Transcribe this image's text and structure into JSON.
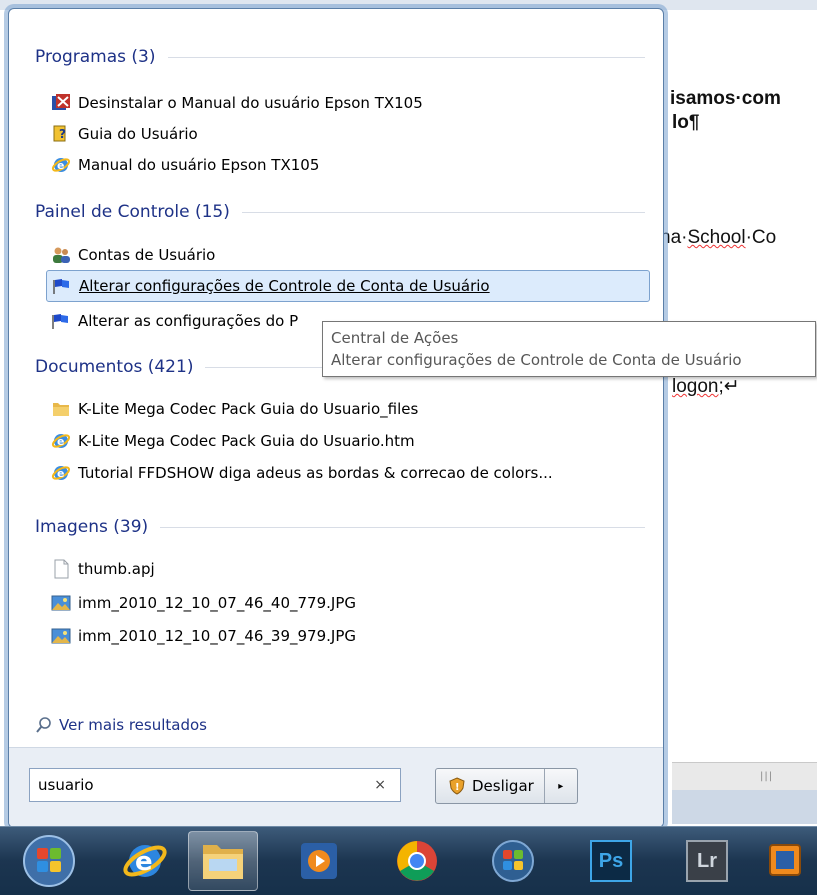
{
  "background_document": {
    "line1": "isamos·com",
    "line2": "lo¶",
    "line3_prefix": "na·",
    "line3_word": "School",
    "line3_suffix": "·Co",
    "line4_word": "logon",
    "line4_suffix": ";↵"
  },
  "groups": {
    "programs": {
      "title": "Programas (3)",
      "items": [
        {
          "label": "Desinstalar o Manual do usuário Epson TX105",
          "icon": "uninstall-icon"
        },
        {
          "label": "Guia do Usuário",
          "icon": "help-guide-icon"
        },
        {
          "label": "Manual do usuário Epson TX105",
          "icon": "internet-explorer-icon"
        }
      ]
    },
    "control_panel": {
      "title": "Painel de Controle (15)",
      "items": [
        {
          "label": "Contas de Usuário",
          "icon": "user-accounts-icon"
        },
        {
          "label": "Alterar configurações de Controle de Conta de Usuário",
          "icon": "action-center-flag-icon",
          "selected": true
        },
        {
          "label": "Alterar as configurações do P",
          "icon": "action-center-flag-icon"
        }
      ]
    },
    "documents": {
      "title": "Documentos (421)",
      "items": [
        {
          "label": "K-Lite Mega Codec Pack   Guia do Usuario_files",
          "icon": "folder-icon"
        },
        {
          "label": "K-Lite Mega Codec Pack   Guia do Usuario.htm",
          "icon": "internet-explorer-icon"
        },
        {
          "label": "Tutorial FFDSHOW  diga adeus as bordas & correcao de colors...",
          "icon": "internet-explorer-icon"
        }
      ]
    },
    "images": {
      "title": "Imagens (39)",
      "items": [
        {
          "label": "thumb.apj",
          "icon": "blank-file-icon"
        },
        {
          "label": "imm_2010_12_10_07_46_40_779.JPG",
          "icon": "image-file-icon"
        },
        {
          "label": "imm_2010_12_10_07_46_39_979.JPG",
          "icon": "image-file-icon"
        }
      ]
    }
  },
  "tooltip": {
    "title": "Central de Ações",
    "description": "Alterar configurações de Controle de Conta de Usuário"
  },
  "more_results": "Ver mais resultados",
  "search": {
    "value": "usuario",
    "clear_symbol": "×"
  },
  "shutdown": {
    "label": "Desligar",
    "arrow": "▸"
  },
  "taskbar": {
    "items": [
      "start-orb-icon",
      "internet-explorer-icon",
      "file-explorer-icon",
      "media-player-icon",
      "chrome-icon",
      "windows-icon",
      "photoshop-icon",
      "lightroom-icon",
      "virtualbox-icon"
    ],
    "photoshop_text": "Ps",
    "lightroom_text": "Lr"
  },
  "colors": {
    "group_title": "#1e3287",
    "selection": "#dcebfc",
    "taskbar": "#1c3550"
  }
}
